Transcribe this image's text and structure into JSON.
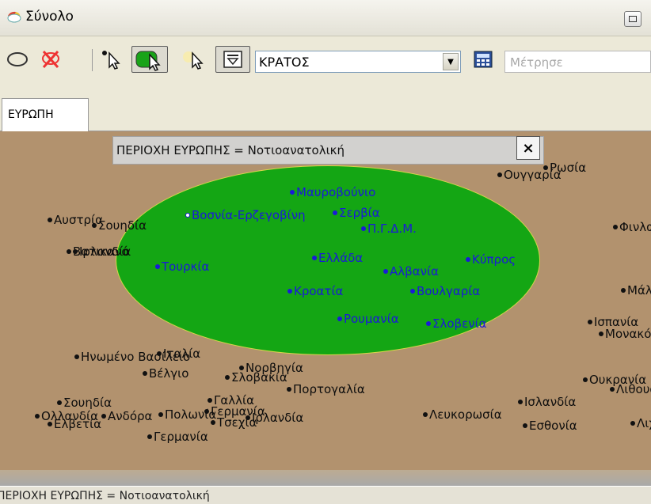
{
  "window": {
    "title": "Σύνολο"
  },
  "toolbar": {
    "layer_combo": "ΚΡΑΤΟΣ",
    "measure_placeholder": "Μέτρησε"
  },
  "tabs": [
    {
      "label": "ΕΥΡΩΠΗ"
    }
  ],
  "map": {
    "selection_label": "ΠΕΡΙΟΧΗ ΕΥΡΩΠΗΣ = Νοτιοανατολική",
    "close_symbol": "×",
    "inside_points": [
      "Μαυροβούνιο",
      "Βοσνία-Ερζεγοβίνη",
      "Σερβία",
      "Π.Γ.Δ.Μ.",
      "Τουρκία",
      "Ελλάδα",
      "Κύπρος",
      "Αλβανία",
      "Κροατία",
      "Βουλγαρία",
      "Ρουμανία",
      "Σλοβενία"
    ],
    "outside_points": [
      "Ρωσία",
      "Ουγγαρία",
      "Αυστρία",
      "Σουηδία",
      "Φινλανδία",
      "Βατικανό",
      "Ιρλανδία",
      "Μάλτα",
      "Ισπανία",
      "Μονακό",
      "Ηνωμένο Βασίλειο",
      "Ιταλία",
      "Βέλγιο",
      "Νορβηγία",
      "Σλοβακία",
      "Ουκρανία",
      "Πορτογαλία",
      "Γαλλία",
      "Σουηδία",
      "Λιθουανία",
      "Ολλανδία",
      "Ελβετία",
      "Ανδόρα",
      "Πολωνία",
      "Γερμανία",
      "Τσεχία",
      "Ιρλανδία",
      "Λευκορωσία",
      "Ισλανδία",
      "Εσθονία",
      "Λιχτενστάιν",
      "Γερμανία"
    ]
  },
  "status": {
    "text": "ΠΕΡΙΟΧΗ ΕΥΡΩΠΗΣ = Νοτιοανατολική"
  }
}
